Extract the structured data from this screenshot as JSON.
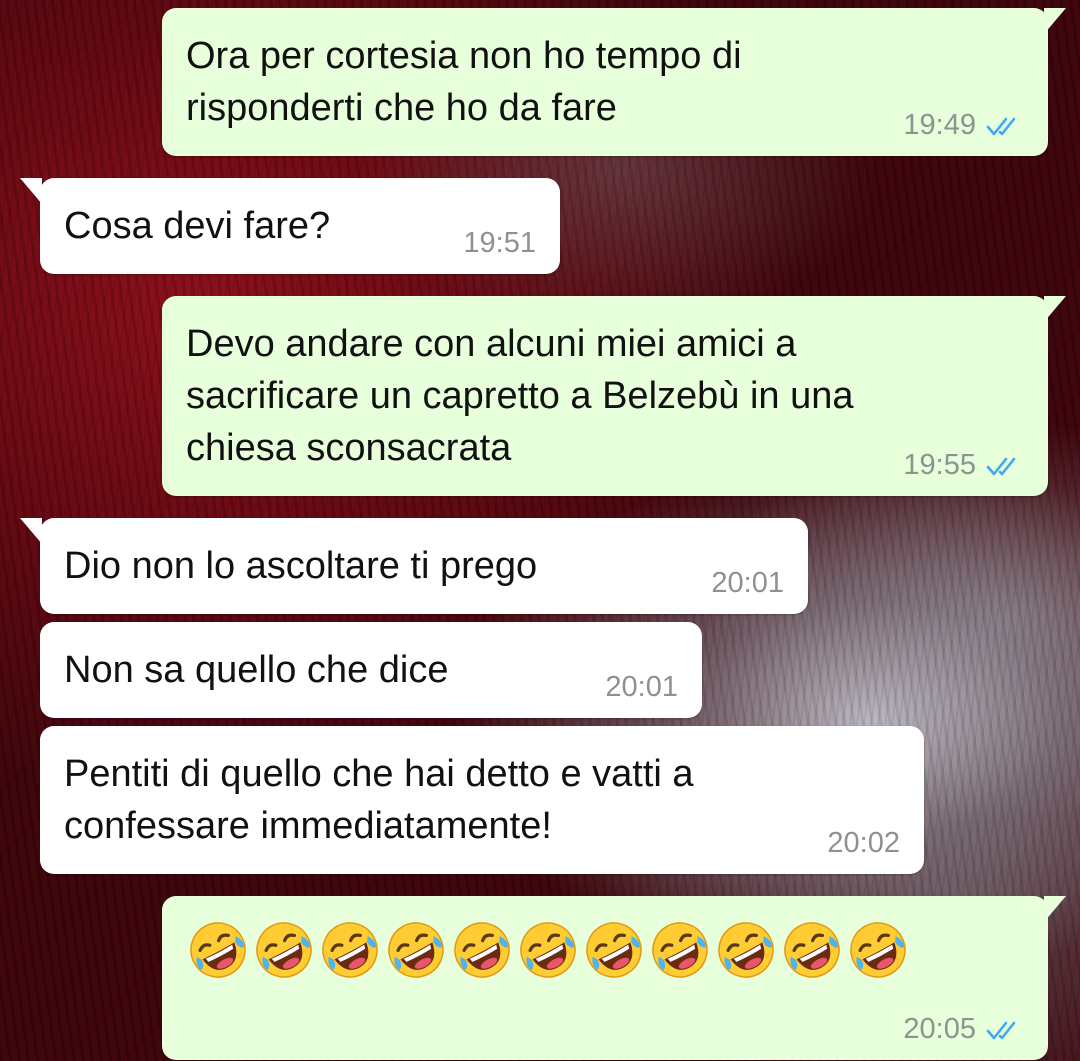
{
  "chat": {
    "messages": [
      {
        "direction": "outgoing",
        "text": "Ora per cortesia non ho tempo di\nrisponderti che ho da fare",
        "time": "19:49",
        "status": "read"
      },
      {
        "direction": "incoming",
        "text": "Cosa devi fare?",
        "time": "19:51"
      },
      {
        "direction": "outgoing",
        "text": "Devo andare con alcuni miei amici a\nsacrificare un capretto a Belzebù in una\nchiesa sconsacrata",
        "time": "19:55",
        "status": "read"
      },
      {
        "direction": "incoming",
        "text": "Dio non lo ascoltare ti prego",
        "time": "20:01"
      },
      {
        "direction": "incoming",
        "text": "Non sa quello che dice",
        "time": "20:01"
      },
      {
        "direction": "incoming",
        "text": "Pentiti di quello che hai detto e vatti a\nconfessare immediatamente!",
        "time": "20:02"
      },
      {
        "direction": "outgoing",
        "emoji": "rolling-on-the-floor-laughing",
        "emoji_count": 11,
        "time": "20:05",
        "status": "read"
      }
    ]
  },
  "colors": {
    "outgoing_bubble": "#e7ffdb",
    "incoming_bubble": "#ffffff",
    "read_ticks": "#3fa9f5",
    "timestamp": "#8c948f"
  },
  "icons": {
    "read_status": "double-check-icon",
    "emoji": "rolling-on-the-floor-laughing-emoji"
  }
}
